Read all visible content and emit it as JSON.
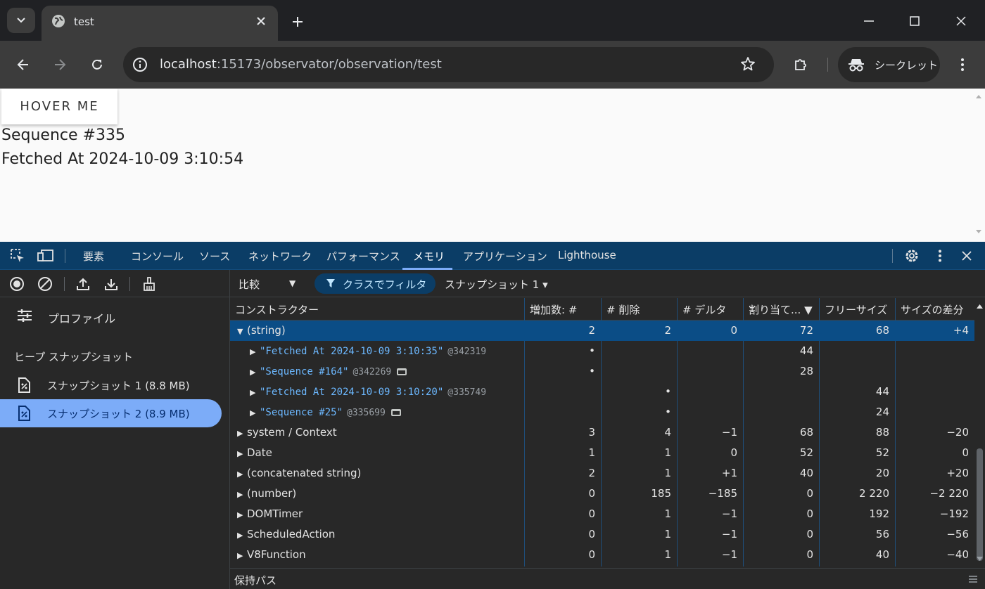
{
  "browser": {
    "tab_title": "test",
    "url_host": "localhost",
    "url_rest": ":15173/observator/observation/test",
    "incognito_label": "シークレット"
  },
  "page": {
    "hover_button_label": "HOVER ME",
    "sequence_text": "Sequence #335",
    "fetched_text": "Fetched At 2024-10-09 3:10:54"
  },
  "devtools": {
    "tabs": [
      "要素",
      "コンソール",
      "ソース",
      "ネットワーク",
      "パフォーマンス",
      "メモリ",
      "アプリケーション",
      "Lighthouse"
    ],
    "active_tab": "メモリ",
    "sidebar": {
      "profiles_label": "プロファイル",
      "heap_snapshots_header": "ヒープ スナップショット",
      "snapshots": [
        {
          "label": "スナップショット 1 (8.8 MB)",
          "selected": false
        },
        {
          "label": "スナップショット 2 (8.9 MB)",
          "selected": true
        }
      ]
    },
    "toolbar": {
      "mode": "比較",
      "filter_label": "クラスでフィルタ",
      "base_snapshot": "スナップショット 1 ▾"
    },
    "columns": [
      "コンストラクター",
      "増加数: #",
      "# 削除",
      "# デルタ",
      "割り当て... ▼",
      "フリーサイズ",
      "サイズの差分"
    ],
    "rows": [
      {
        "name": "(string)",
        "kind": "group",
        "expanded": true,
        "selected": true,
        "new": "2",
        "deleted": "2",
        "delta": "0",
        "alloc": "72",
        "freed": "68",
        "sizediff": "+4"
      },
      {
        "name": "\"Fetched At 2024-10-09 3:10:35\"",
        "id": "@342319",
        "kind": "literal",
        "new": "•",
        "deleted": "",
        "delta": "",
        "alloc": "44",
        "freed": "",
        "sizediff": ""
      },
      {
        "name": "\"Sequence #164\"",
        "id": "@342269",
        "kind": "literal",
        "window": true,
        "new": "•",
        "deleted": "",
        "delta": "",
        "alloc": "28",
        "freed": "",
        "sizediff": ""
      },
      {
        "name": "\"Fetched At 2024-10-09 3:10:20\"",
        "id": "@335749",
        "kind": "literal",
        "new": "",
        "deleted": "•",
        "delta": "",
        "alloc": "",
        "freed": "44",
        "sizediff": ""
      },
      {
        "name": "\"Sequence #25\"",
        "id": "@335699",
        "kind": "literal",
        "window": true,
        "new": "",
        "deleted": "•",
        "delta": "",
        "alloc": "",
        "freed": "24",
        "sizediff": ""
      },
      {
        "name": "system / Context",
        "kind": "group",
        "new": "3",
        "deleted": "4",
        "delta": "−1",
        "alloc": "68",
        "freed": "88",
        "sizediff": "−20"
      },
      {
        "name": "Date",
        "kind": "group",
        "new": "1",
        "deleted": "1",
        "delta": "0",
        "alloc": "52",
        "freed": "52",
        "sizediff": "0"
      },
      {
        "name": "(concatenated string)",
        "kind": "group",
        "new": "2",
        "deleted": "1",
        "delta": "+1",
        "alloc": "40",
        "freed": "20",
        "sizediff": "+20"
      },
      {
        "name": "(number)",
        "kind": "group",
        "new": "0",
        "deleted": "185",
        "delta": "−185",
        "alloc": "0",
        "freed": "2 220",
        "sizediff": "−2 220"
      },
      {
        "name": "DOMTimer",
        "kind": "group",
        "new": "0",
        "deleted": "1",
        "delta": "−1",
        "alloc": "0",
        "freed": "192",
        "sizediff": "−192"
      },
      {
        "name": "ScheduledAction",
        "kind": "group",
        "new": "0",
        "deleted": "1",
        "delta": "−1",
        "alloc": "0",
        "freed": "56",
        "sizediff": "−56"
      },
      {
        "name": "V8Function",
        "kind": "group",
        "new": "0",
        "deleted": "1",
        "delta": "−1",
        "alloc": "0",
        "freed": "40",
        "sizediff": "−40"
      }
    ],
    "retainers_label": "保持パス"
  },
  "icons": {
    "tab_search": "chevron-down-icon",
    "favicon": "globe-icon",
    "tab_close": "close-icon",
    "new_tab": "plus-icon",
    "back": "arrow-left-icon",
    "forward": "arrow-right-icon",
    "reload": "reload-icon",
    "site_info": "info-icon",
    "bookmark": "star-icon",
    "extensions": "puzzle-icon",
    "incognito": "incognito-icon",
    "menu": "kebab-icon"
  },
  "colors": {
    "devtools_accent": "#7cacf8",
    "devtools_topbar": "#0b3d66",
    "selected_row": "#0b4d86",
    "string_literal": "#6cb8ff"
  }
}
